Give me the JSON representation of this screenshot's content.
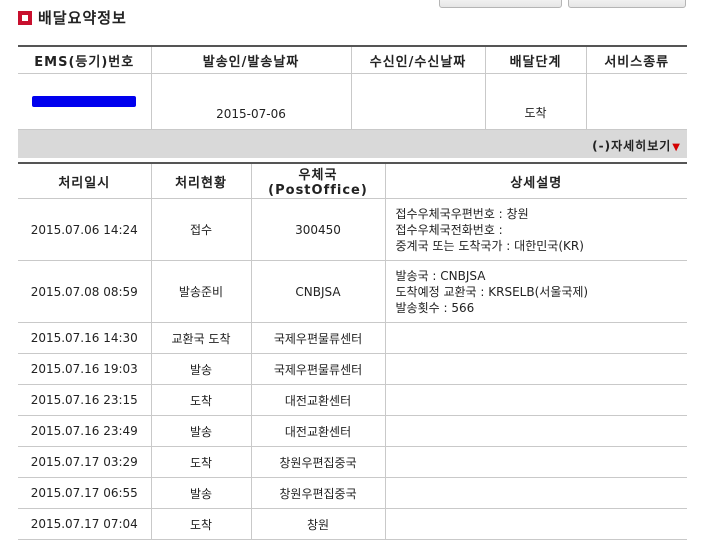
{
  "section_title": "배달요약정보",
  "summary": {
    "headers": [
      "EMS(등기)번호",
      "발송인/발송날짜",
      "수신인/수신날짜",
      "배달단계",
      "서비스종류"
    ],
    "row": {
      "tracking_number": "",
      "sender_date": "2015-07-06",
      "receiver_date": "",
      "stage": "도착",
      "service": ""
    }
  },
  "detail_toggle_label": "(-)자세히보기",
  "detail": {
    "headers": [
      "처리일시",
      "처리현황",
      "우체국(PostOffice)",
      "상세설명"
    ],
    "rows": [
      {
        "datetime": "2015.07.06 14:24",
        "status": "접수",
        "office": "300450",
        "desc": [
          "접수우체국우편번호 : 창원",
          "접수우체국전화번호 :",
          "중계국 또는 도착국가 : 대한민국(KR)"
        ]
      },
      {
        "datetime": "2015.07.08 08:59",
        "status": "발송준비",
        "office": "CNBJSA",
        "desc": [
          "발송국 : CNBJSA",
          "도착예정 교환국 : KRSELB(서울국제)",
          "발송횟수 : 566"
        ]
      },
      {
        "datetime": "2015.07.16 14:30",
        "status": "교환국 도착",
        "office": "국제우편물류센터",
        "desc": []
      },
      {
        "datetime": "2015.07.16 19:03",
        "status": "발송",
        "office": "국제우편물류센터",
        "desc": []
      },
      {
        "datetime": "2015.07.16 23:15",
        "status": "도착",
        "office": "대전교환센터",
        "desc": []
      },
      {
        "datetime": "2015.07.16 23:49",
        "status": "발송",
        "office": "대전교환센터",
        "desc": []
      },
      {
        "datetime": "2015.07.17 03:29",
        "status": "도착",
        "office": "창원우편집중국",
        "desc": []
      },
      {
        "datetime": "2015.07.17 06:55",
        "status": "발송",
        "office": "창원우편집중국",
        "desc": []
      },
      {
        "datetime": "2015.07.17 07:04",
        "status": "도착",
        "office": "창원",
        "desc": []
      }
    ]
  },
  "colors": {
    "accent_red": "#c8102e",
    "bar_gray": "#d9d9d9",
    "redaction": "#0000ee"
  }
}
